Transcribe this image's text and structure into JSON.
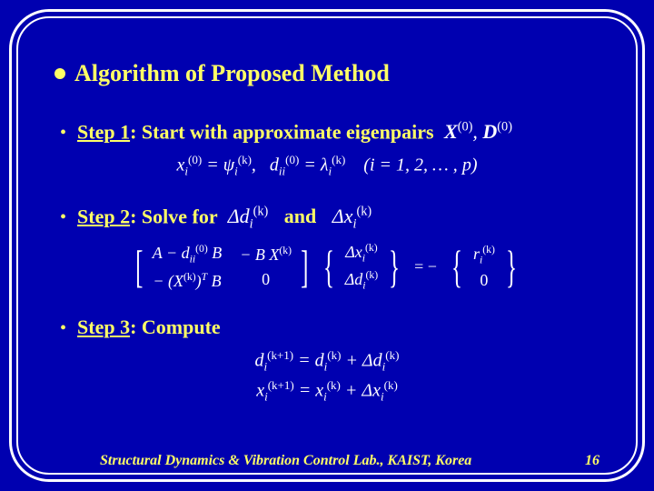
{
  "heading": "Algorithm of Proposed Method",
  "steps": {
    "s1": {
      "label_u": "Step 1",
      "label_tail": ": Start with approximate eigenpairs",
      "math_after": "X (0), D (0)",
      "eq": "x_i^(0) = ψ_i^(k),  d_ii^(0) = λ_i^(k)   (i = 1, 2, … , p)"
    },
    "s2": {
      "label_u": "Step 2",
      "label_tail": ": Solve for",
      "mid_math1": "Δd_i^(k)",
      "and": "and",
      "mid_math2": "Δx_i^(k)",
      "m": {
        "a11": "A − d_ii^(0) B",
        "a12": "− B X^(k)",
        "a21": "− (X^(k))^T B",
        "a22": "0",
        "v1": "Δx_i^(k)",
        "v2": "Δd_i^(k)",
        "eq": "= −",
        "r1": "r_i^(k)",
        "r2": "0"
      }
    },
    "s3": {
      "label_u": "Step 3",
      "label_tail": ": Compute",
      "u1": "d_i^(k+1) = d_i^(k) + Δd_i^(k)",
      "u2": "x_i^(k+1) = x_i^(k) + Δx_i^(k)"
    }
  },
  "footer": {
    "lab": "Structural Dynamics & Vibration Control Lab., KAIST, Korea",
    "page": "16"
  }
}
